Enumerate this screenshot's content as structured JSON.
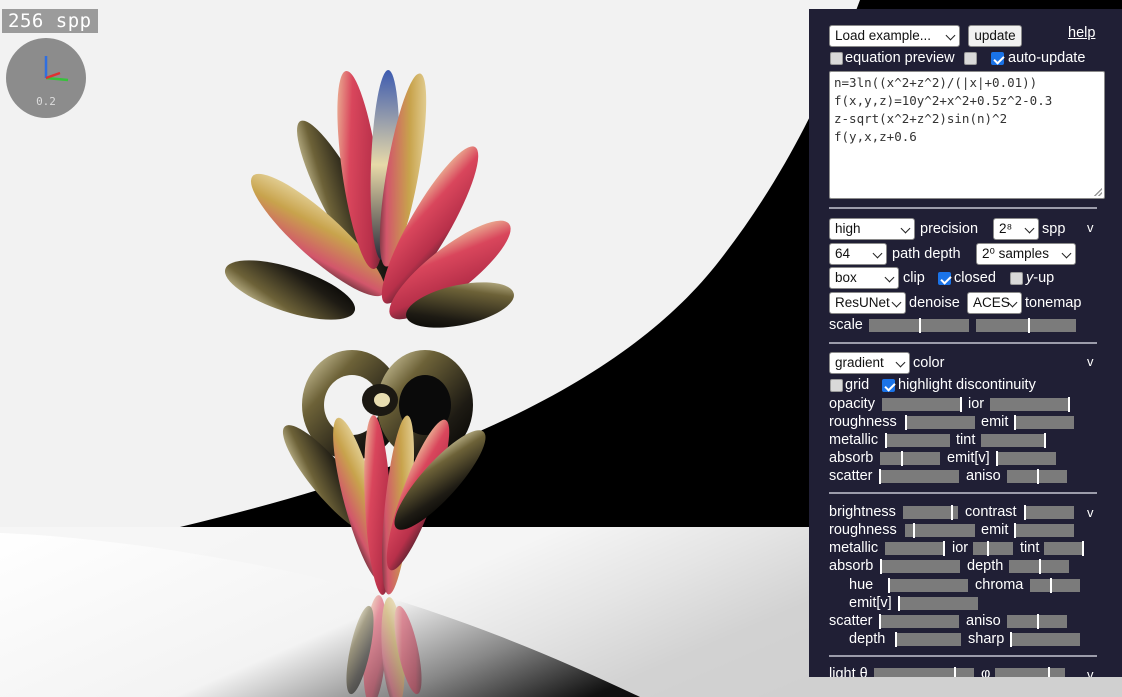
{
  "viewport": {
    "spp_badge": "256 spp",
    "gizmo_label": "0.2"
  },
  "panel": {
    "top": {
      "example_select": "Load example...",
      "update_button": "update",
      "help_link": "help",
      "equation_preview_label": "equation preview",
      "equation_preview_checked": false,
      "extra_checked": false,
      "auto_update_label": "auto-update",
      "auto_update_checked": true
    },
    "equation_lines": [
      "n=3ln((x^2+z^2)/(|x|+0.01))",
      "f(x,y,z)=10y^2+x^2+0.5z^2-0.3",
      "z-sqrt(x^2+z^2)sin(n)^2",
      "f(y,x,z+0.6"
    ],
    "render": {
      "precision_value": "high",
      "precision_label": "precision",
      "spp_value": "2⁸",
      "spp_label": "spp",
      "collapse": "v",
      "depth_value": "64",
      "depth_label": "path depth",
      "samples_value": "2⁰ samples",
      "clip_value": "box",
      "clip_label": "clip",
      "closed_label": "closed",
      "closed_checked": true,
      "yup_var": "y",
      "yup_label": "-up",
      "yup_checked": false,
      "denoise_value": "ResUNet",
      "denoise_label": "denoise",
      "tonemap_value": "ACES",
      "tonemap_label": "tonemap",
      "scale_label": "scale",
      "scale_levels": [
        0.5,
        0.52
      ]
    },
    "material": {
      "color_value": "gradient",
      "color_label": "color",
      "collapse": "v",
      "grid_label": "grid",
      "grid_checked": false,
      "highlight_label": "highlight discontinuity",
      "highlight_checked": true,
      "labels": {
        "opacity": "opacity",
        "ior": "ior",
        "roughness": "roughness",
        "emit": "emit",
        "metallic": "metallic",
        "tint": "tint",
        "absorb": "absorb",
        "emitv": "emit[v]",
        "scatter": "scatter",
        "aniso": "aniso"
      },
      "levels": {
        "opacity": 0.98,
        "ior": 0.98,
        "roughness": 0.0,
        "emit": 0.0,
        "metallic": 0.0,
        "tint": 0.98,
        "absorb": 0.35,
        "emitv": 0.0,
        "scatter": 0.0,
        "aniso": 0.5
      }
    },
    "volume": {
      "collapse": "v",
      "labels": {
        "brightness": "brightness",
        "contrast": "contrast",
        "roughness": "roughness",
        "emit": "emit",
        "metallic": "metallic",
        "ior": "ior",
        "tint": "tint",
        "absorb": "absorb",
        "depth": "depth",
        "hue": "hue",
        "chroma": "chroma",
        "emitv": "emit[v]",
        "scatter": "scatter",
        "aniso": "aniso",
        "depth2": "depth",
        "sharp": "sharp"
      },
      "levels": {
        "brightness": 0.88,
        "contrast": 0.0,
        "roughness": 0.12,
        "emit": 0.0,
        "metallic": 0.98,
        "ior": 0.35,
        "tint": 0.98,
        "absorb": 0.0,
        "depth": 0.5,
        "hue": 0.0,
        "chroma": 0.4,
        "emitv": 0.0,
        "scatter": 0.0,
        "aniso": 0.5,
        "depth2": 0.0,
        "sharp": 0.0
      }
    },
    "light": {
      "theta_label": "light θ",
      "phi_label": "φ",
      "collapse": "v",
      "levels": {
        "theta": 0.8,
        "phi": 0.75
      }
    }
  },
  "colors": {
    "panel_bg": "#201f35",
    "checkbox_on": "#1a73e8",
    "slider_track": "#7b7b7b"
  }
}
